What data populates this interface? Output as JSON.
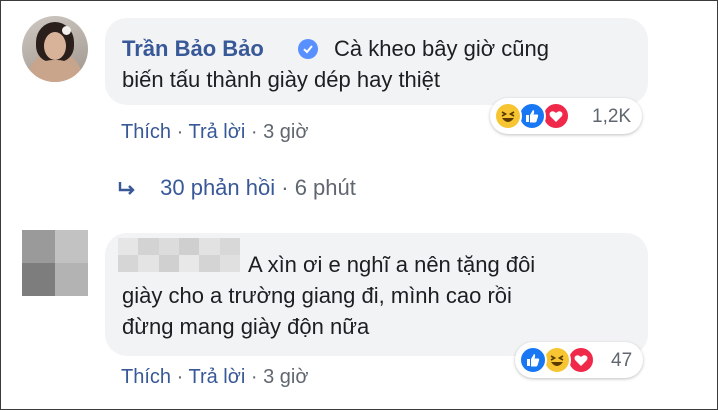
{
  "comments": [
    {
      "author": "Trần Bảo Bảo",
      "text_lines": [
        "Cà kheo bây giờ cũng",
        "biến tấu thành giày dép hay thiệt"
      ],
      "reactions": [
        "haha",
        "like",
        "love"
      ],
      "reaction_count": "1,2K",
      "actions": {
        "like": "Thích",
        "reply": "Trả lời",
        "separator": "·",
        "time": "3 giờ"
      },
      "replies": {
        "label": "30 phản hồi",
        "separator": "·",
        "time": "6 phút"
      }
    },
    {
      "author": "",
      "text_lines": [
        "A xìn ơi e nghĩ a nên tặng đôi",
        "giày cho a trường giang đi, mình cao rồi",
        "đừng mang giày độn nữa"
      ],
      "reactions": [
        "like",
        "haha",
        "love"
      ],
      "reaction_count": "47",
      "actions": {
        "like": "Thích",
        "reply": "Trả lời",
        "separator": "·",
        "time": "3 giờ"
      }
    }
  ],
  "colors": {
    "link": "#385898",
    "meta": "#606770",
    "bubble": "#f2f3f5",
    "like": "#1877f2",
    "love": "#f0284a",
    "haha": "#f7c531",
    "verified": "#5890ff"
  }
}
